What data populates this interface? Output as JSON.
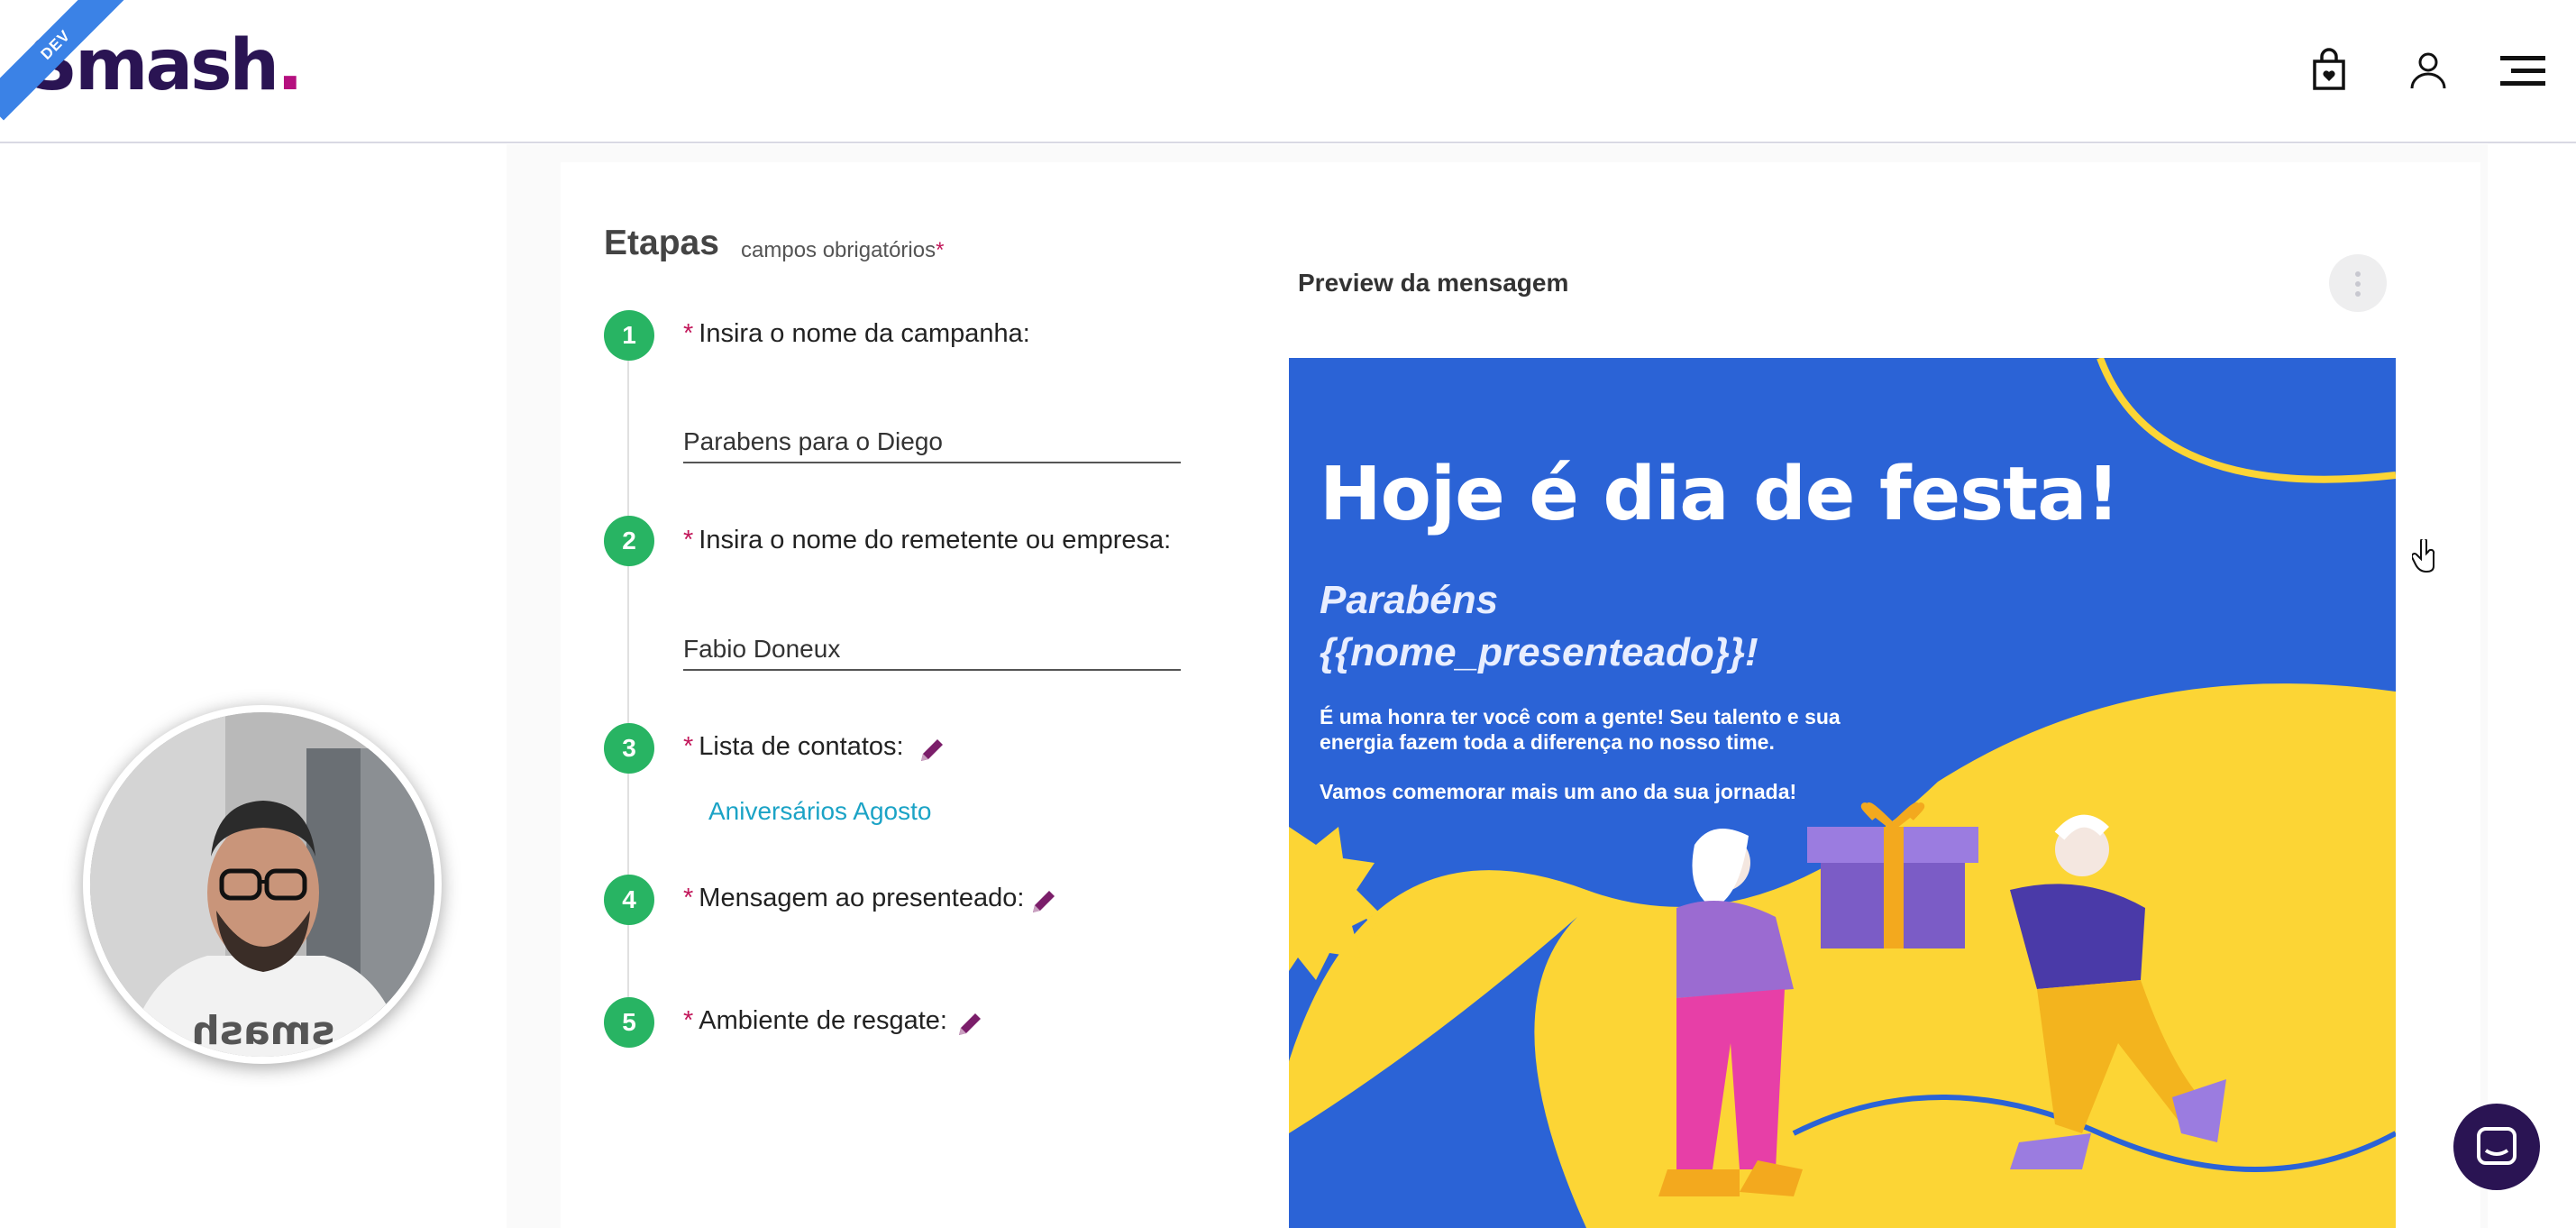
{
  "header": {
    "dev_badge": "DEV",
    "logo": "Smash",
    "logo_dot": ".",
    "icons": [
      "shopping-bag-icon",
      "user-icon",
      "menu-icon"
    ]
  },
  "steps": {
    "title": "Etapas",
    "required_note": "campos obrigatórios",
    "required_star": "*",
    "items": [
      {
        "number": "1",
        "star": "*",
        "label": "Insira o nome da campanha:",
        "value": "Parabens para o Diego"
      },
      {
        "number": "2",
        "star": "*",
        "label": "Insira o nome do remetente ou empresa:",
        "value": "Fabio Doneux"
      },
      {
        "number": "3",
        "star": "*",
        "label": "Lista de contatos:",
        "link": "Aniversários Agosto"
      },
      {
        "number": "4",
        "star": "*",
        "label": "Mensagem ao presenteado:"
      },
      {
        "number": "5",
        "star": "*",
        "label": "Ambiente de resgate:"
      }
    ]
  },
  "preview": {
    "title": "Preview da mensagem",
    "headline": "Hoje é dia de festa!",
    "sub_line1": "Parabéns",
    "sub_line2": "{{nome_presenteado}}!",
    "body": "É uma honra ter você com a gente! Seu talento e sua energia fazem toda a diferença no nosso time.",
    "body2": "Vamos comemorar mais um ano da sua jornada!"
  },
  "webcam": {
    "shirt_text": "smash"
  },
  "colors": {
    "brand": "#2a1453",
    "accent": "#b5107f",
    "step_green": "#28b463",
    "link": "#1ba3c6",
    "preview_blue": "#2b63d6",
    "preview_yellow": "#fcd535"
  }
}
